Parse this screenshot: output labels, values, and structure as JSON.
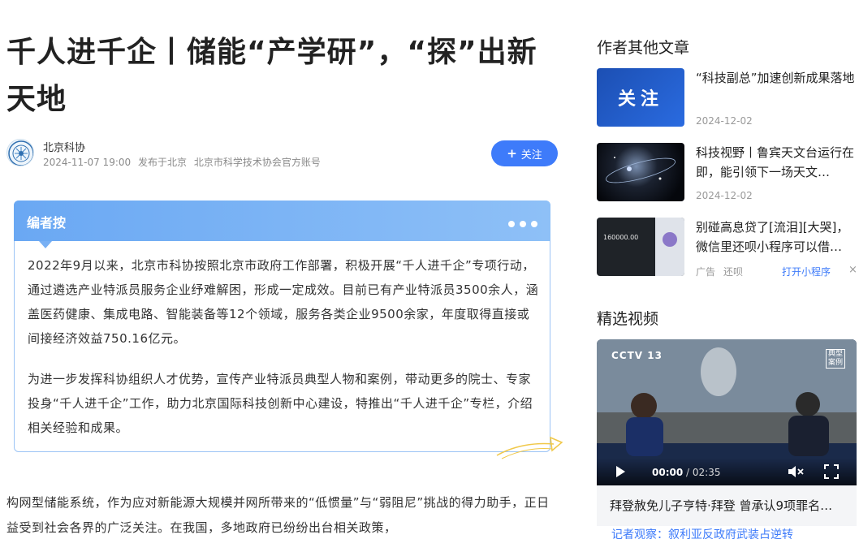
{
  "article": {
    "title": "千人进千企丨储能“产学研”，“探”出新天地",
    "author": "北京科协",
    "date": "2024-11-07 19:00",
    "location": "发布于北京",
    "account_desc": "北京市科学技术协会官方账号",
    "follow_label": "关注",
    "editor_note": {
      "heading": "编者按",
      "paragraphs": [
        "2022年9月以来，北京市科协按照北京市政府工作部署，积极开展“千人进千企”专项行动，通过遴选产业特派员服务企业纾难解困，形成一定成效。目前已有产业特派员3500余人，涵盖医药健康、集成电路、智能装备等12个领域，服务各类企业9500余家，年度取得直接或间接经济效益750.16亿元。",
        "为进一步发挥科协组织人才优势，宣传产业特派员典型人物和案例，带动更多的院士、专家投身“千人进千企”工作，助力北京国际科技创新中心建设，特推出“千人进千企”专栏，介绍相关经验和成果。"
      ]
    },
    "body": "构网型储能系统，作为应对新能源大规模并网所带来的“低惯量”与“弱阻尼”挑战的得力助手，正日益受到社会各界的广泛关注。在我国，多地政府已纷纷出台相关政策，"
  },
  "sidebar": {
    "other_heading": "作者其他文章",
    "articles": [
      {
        "title": "“科技副总”加速创新成果落地",
        "date": "2024-12-02",
        "thumb_text": "关注"
      },
      {
        "title": "科技视野丨鲁宾天文台运行在即，能引领下一场天文…",
        "date": "2024-12-02"
      }
    ],
    "ad": {
      "title": "别碰高息贷了[流泪][大哭]，微信里还呗小程序可以借…",
      "tag": "广告",
      "source": "还呗",
      "action": "打开小程序",
      "close": "×",
      "thumb_amount": "160000.00"
    },
    "video_heading": "精选视频",
    "video": {
      "channel": "CCTV 13",
      "corner": "典型案例",
      "current_time": "00:00",
      "duration": "02:35",
      "caption": "拜登赦免儿子亨特·拜登 曾承认9项罪名…",
      "next_caption": "记者观察：叙利亚反政府武装占逆转"
    }
  }
}
